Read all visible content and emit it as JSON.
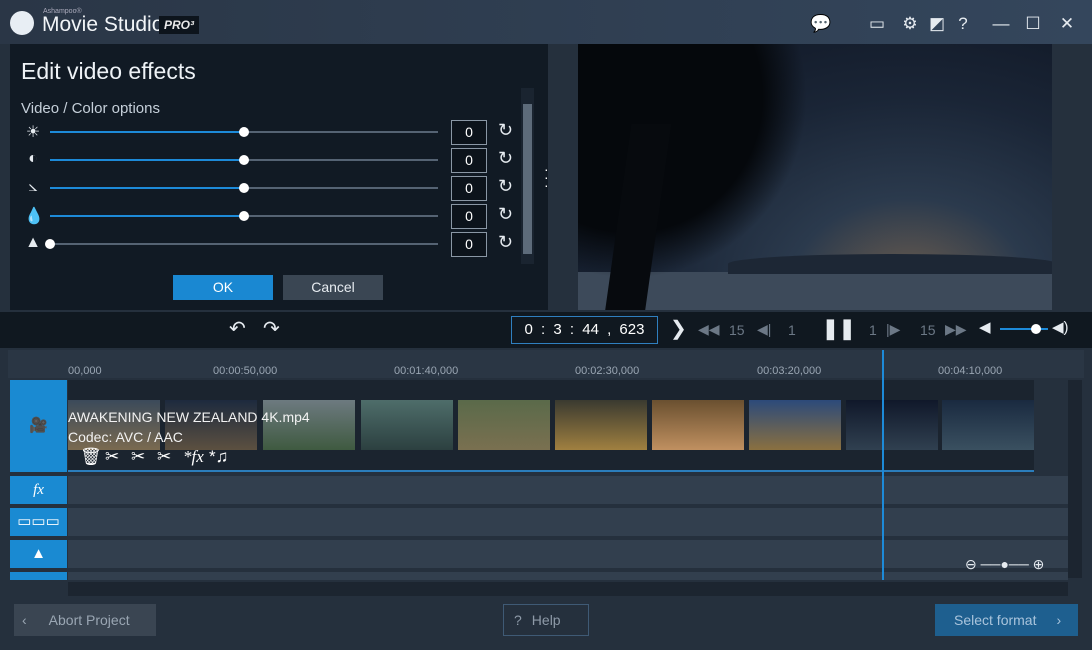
{
  "app": {
    "brand_small": "Ashampoo®",
    "title": "Movie Studio",
    "edition": "PRO³"
  },
  "titlebar_icons": [
    "chat-icon",
    "monitor-icon",
    "gear-icon",
    "edit-icon",
    "help-icon",
    "minimize-icon",
    "maximize-icon",
    "close-icon"
  ],
  "effects": {
    "title": "Edit video effects",
    "section": "Video / Color options",
    "sliders": [
      {
        "icon": "brightness-icon",
        "value": "0",
        "level": 0.5
      },
      {
        "icon": "contrast-icon",
        "value": "0",
        "level": 0.5
      },
      {
        "icon": "gamma-icon",
        "value": "0",
        "level": 0.5
      },
      {
        "icon": "saturation-icon",
        "value": "0",
        "level": 0.5
      },
      {
        "icon": "sharpness-icon",
        "value": "0",
        "level": 0.0
      }
    ],
    "ok": "OK",
    "cancel": "Cancel"
  },
  "transport": {
    "timecode": "0 : 3 : 44 , 623",
    "back15": "15",
    "back1": "1",
    "fwd1": "1",
    "fwd15": "15",
    "volume": 0.7
  },
  "ruler": [
    "00,000",
    "00:00:50,000",
    "00:01:40,000",
    "00:02:30,000",
    "00:03:20,000",
    "00:04:10,000"
  ],
  "clip": {
    "name": "AWAKENING   NEW ZEALAND 4K.mp4",
    "codec": "Codec: AVC / AAC"
  },
  "footer": {
    "abort": "Abort Project",
    "help": "Help",
    "select": "Select format"
  },
  "colors": {
    "accent": "#1a8ad2",
    "panel": "#111a24"
  }
}
